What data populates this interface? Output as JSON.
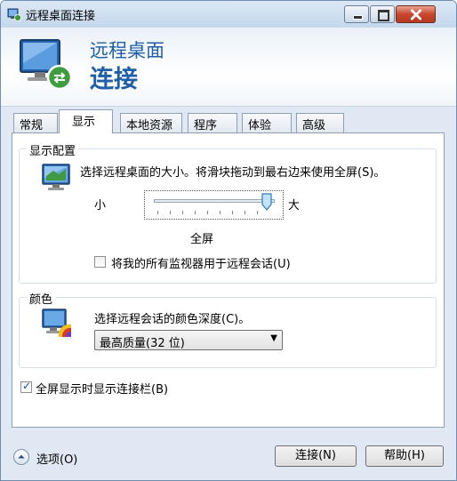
{
  "window": {
    "title": "远程桌面连接"
  },
  "header": {
    "line1": "远程桌面",
    "line2": "连接"
  },
  "tabs": [
    "常规",
    "显示",
    "本地资源",
    "程序",
    "体验",
    "高级"
  ],
  "active_tab": "显示",
  "display_config": {
    "group_label": "显示配置",
    "description": "选择远程桌面的大小。将滑块拖动到最右边来使用全屏(S)。",
    "slider_min_label": "小",
    "slider_max_label": "大",
    "slider_value_label": "全屏",
    "slider_position": 1.0,
    "all_monitors_label": "将我的所有监视器用于远程会话(U)",
    "all_monitors_checked": false
  },
  "colors": {
    "group_label": "颜色",
    "description": "选择远程会话的颜色深度(C)。",
    "selected_depth": "最高质量(32 位)"
  },
  "connection_bar": {
    "label": "全屏显示时显示连接栏(B)",
    "checked": true
  },
  "bottom": {
    "options_label": "选项(O)",
    "connect_label": "连接(N)",
    "help_label": "帮助(H)"
  }
}
